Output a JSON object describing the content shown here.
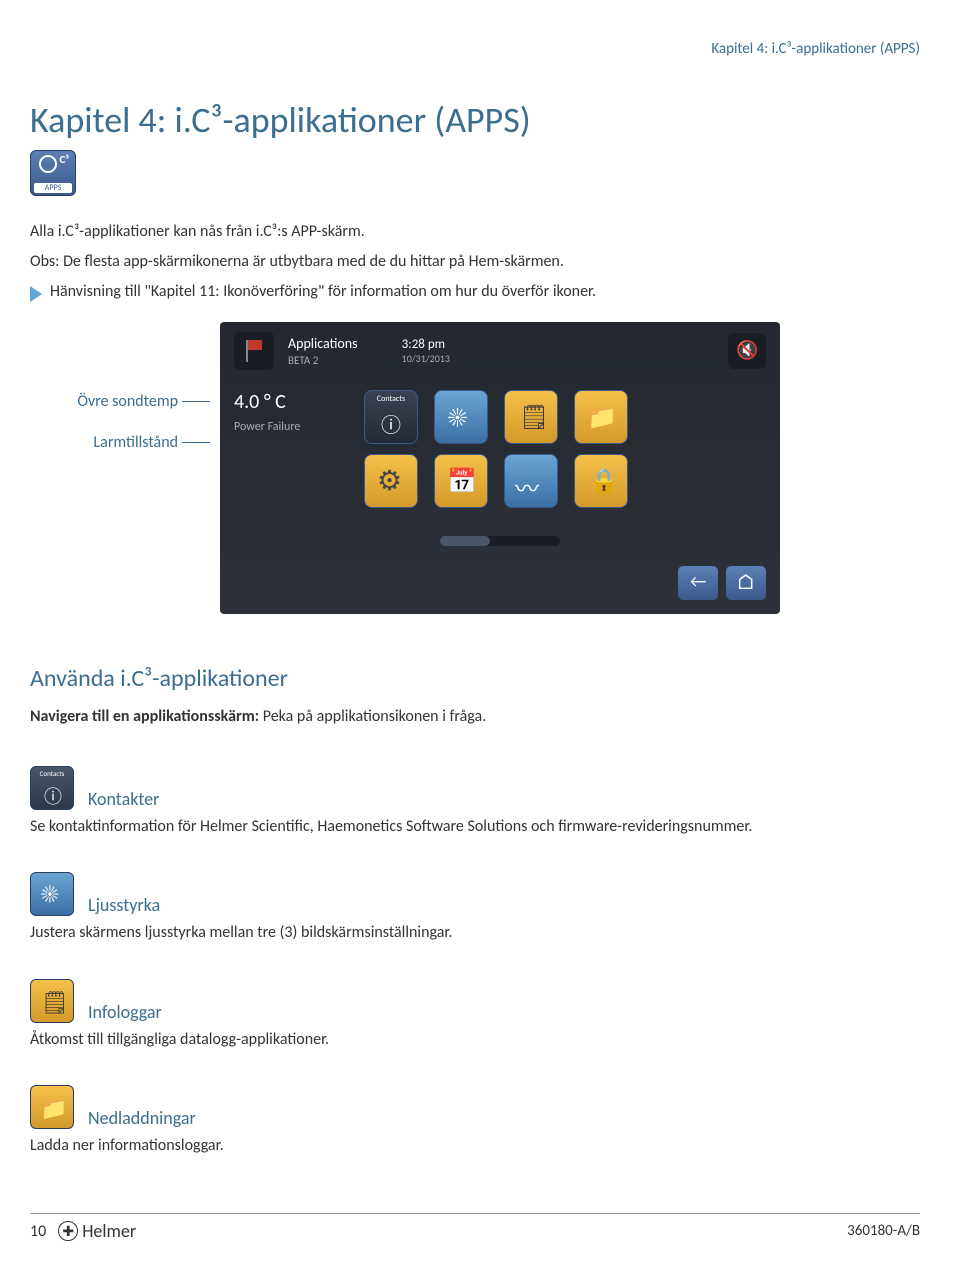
{
  "header_line": "Kapitel 4: i.C³-applikationer (APPS)",
  "h1": "Kapitel 4: i.C³-applikationer (APPS)",
  "apps_badge_label": "APPS",
  "p1": "Alla i.C³-applikationer kan nås från i.C³:s APP-skärm.",
  "p2": "Obs: De flesta app-skärmikonerna är utbytbara med de du hittar på Hem-skärmen.",
  "note_text": "Hänvisning till \"Kapitel 11: Ikonöverföring\" för information om hur du överför ikoner.",
  "left_labels": {
    "l1": "Övre sondtemp",
    "l2": "Larmtillstånd"
  },
  "screen": {
    "title": "Applications",
    "beta": "BETA 2",
    "time": "3:28 pm",
    "date": "10/31/2013",
    "temp": "4.0 ° C",
    "power": "Power Failure"
  },
  "h2": "Använda i.C³-applikationer",
  "nav_bold": "Navigera till en applikationsskärm:",
  "nav_rest": " Peka på applikationsikonen i fråga.",
  "sections": {
    "contacts": {
      "title": "Kontakter",
      "body": "Se kontaktinformation för Helmer Scientific, Haemonetics Software Solutions och firmware-revideringsnummer."
    },
    "brightness": {
      "title": "Ljusstyrka",
      "body": "Justera skärmens ljusstyrka mellan tre (3) bildskärmsinställningar."
    },
    "infologs": {
      "title": "Infologgar",
      "body": "Åtkomst till tillgängliga datalogg-applikationer."
    },
    "downloads": {
      "title": "Nedladdningar",
      "body": "Ladda ner informationsloggar."
    }
  },
  "footer": {
    "page": "10",
    "brand": "Helmer",
    "doc": "360180-A/B"
  }
}
